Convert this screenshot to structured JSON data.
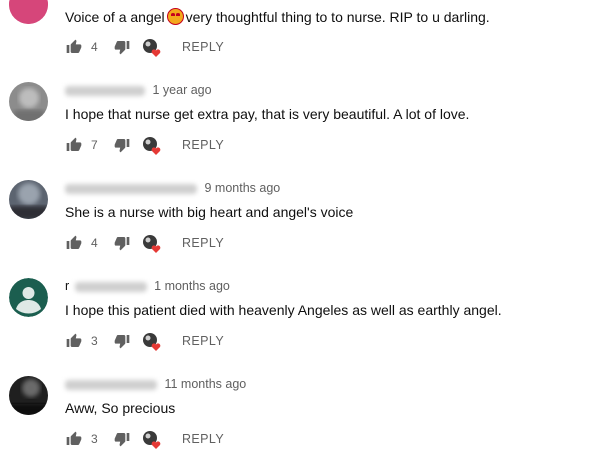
{
  "comments": [
    {
      "author_prefix": "",
      "time": "",
      "text_before_emoji": "Voice of a angel",
      "emoji": "heart-eyes-emoji",
      "text_after_emoji": "very thoughtful thing to to nurse. RIP to u darling.",
      "likes": "4",
      "reply_label": "REPLY",
      "avatar_color": "#d6467a"
    },
    {
      "author_prefix": "",
      "time": "1 year ago",
      "text": "I hope that nurse get extra pay, that is very beautiful. A lot of love.",
      "likes": "7",
      "reply_label": "REPLY",
      "avatar_color": "#9a9a9a"
    },
    {
      "author_prefix": "",
      "time": "9 months ago",
      "text": "She is a nurse with big heart and angel's voice",
      "likes": "4",
      "reply_label": "REPLY",
      "avatar_color": "#4a4a55"
    },
    {
      "author_prefix": "r",
      "time": "1 months ago",
      "text": "I hope this patient died with heavenly Angeles as well as earthly  angel.",
      "likes": "3",
      "reply_label": "REPLY",
      "avatar_color": "#1b5e4f"
    },
    {
      "author_prefix": "",
      "time": "11 months ago",
      "text": "Aww, So precious",
      "likes": "3",
      "reply_label": "REPLY",
      "avatar_color": "#2a2a2a"
    }
  ],
  "colors": {
    "text": "#0f0f0f",
    "meta": "#606060",
    "heart": "#e53935"
  },
  "icons": {
    "like": "thumbs-up-icon",
    "dislike": "thumbs-down-icon",
    "creator_heart": "creator-heart-icon"
  }
}
